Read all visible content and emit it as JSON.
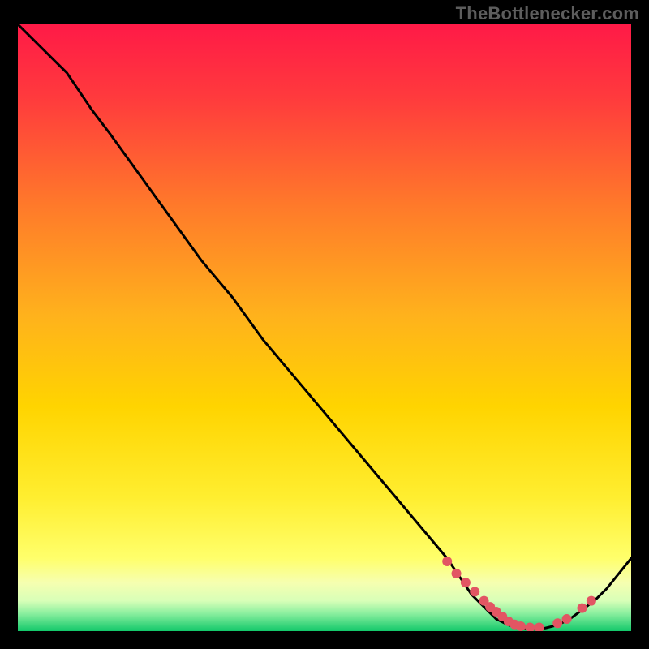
{
  "watermark": "TheBottlenecker.com",
  "chart_data": {
    "type": "line",
    "title": "",
    "xlabel": "",
    "ylabel": "",
    "xlim": [
      0,
      100
    ],
    "ylim": [
      0,
      100
    ],
    "background_gradient_top_rgb": "#ff1a47",
    "background_gradient_mid_rgb": "#ffd400",
    "background_gradient_low_rgb": "#ffff6b",
    "background_gradient_bottom_rgb": "#12c86a",
    "series": [
      {
        "name": "curve",
        "x": [
          0,
          2,
          4,
          6,
          8,
          10,
          12,
          15,
          20,
          25,
          30,
          35,
          40,
          45,
          50,
          55,
          60,
          65,
          70,
          72,
          74,
          76,
          78,
          80,
          82,
          84,
          86,
          88,
          90,
          92,
          94,
          96,
          98,
          100
        ],
        "y": [
          100,
          98,
          96,
          94,
          92,
          89,
          86,
          82,
          75,
          68,
          61,
          55,
          48,
          42,
          36,
          30,
          24,
          18,
          12,
          9,
          6,
          4,
          2,
          1,
          0.5,
          0.3,
          0.5,
          1,
          2,
          3.5,
          5,
          7,
          9.5,
          12
        ]
      }
    ],
    "markers": {
      "name": "marker-dots",
      "color": "#e25563",
      "x": [
        70,
        71.5,
        73,
        74.5,
        76,
        77,
        78,
        79,
        80,
        81,
        82,
        83.5,
        85,
        88,
        89.5,
        92,
        93.5
      ],
      "y": [
        11.5,
        9.5,
        8,
        6.5,
        5,
        4,
        3.2,
        2.4,
        1.6,
        1.1,
        0.8,
        0.6,
        0.6,
        1.3,
        2,
        3.8,
        5
      ]
    }
  }
}
